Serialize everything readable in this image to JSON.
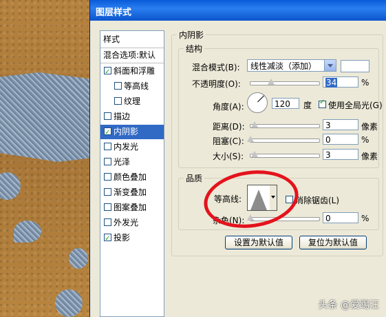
{
  "dialog": {
    "title": "图层样式"
  },
  "styles_panel": {
    "header": "样式",
    "blend_options": "混合选项:默认",
    "items": [
      {
        "label": "斜面和浮雕",
        "checked": true
      },
      {
        "label": "等高线",
        "checked": false
      },
      {
        "label": "纹理",
        "checked": false
      },
      {
        "label": "描边",
        "checked": false
      },
      {
        "label": "内阴影",
        "checked": true
      },
      {
        "label": "内发光",
        "checked": false
      },
      {
        "label": "光泽",
        "checked": false
      },
      {
        "label": "颜色叠加",
        "checked": false
      },
      {
        "label": "渐变叠加",
        "checked": false
      },
      {
        "label": "图案叠加",
        "checked": false
      },
      {
        "label": "外发光",
        "checked": false
      },
      {
        "label": "投影",
        "checked": true
      }
    ]
  },
  "inner_shadow": {
    "section": "内阴影",
    "structure": {
      "title": "结构",
      "blend_mode_label": "混合模式(B):",
      "blend_mode_value": "线性减淡（添加）",
      "opacity_label": "不透明度(O):",
      "opacity_value": "34",
      "percent": "%",
      "angle_label": "角度(A):",
      "angle_value": "120",
      "degree": "度",
      "global_light_label": "使用全局光(G)",
      "distance_label": "距离(D):",
      "distance_value": "3",
      "choke_label": "阻塞(C):",
      "choke_value": "0",
      "size_label": "大小(S):",
      "size_value": "3",
      "px": "像素"
    },
    "quality": {
      "title": "品质",
      "contour_label": "等高线:",
      "antialias_label": "消除锯齿(L)",
      "noise_label": "杂色(N):",
      "noise_value": "0"
    },
    "buttons": {
      "make_default": "设置为默认值",
      "reset_default": "复位为默认值"
    }
  },
  "watermark": "头条 @爱踢汪",
  "colors": {
    "accent": "#316ac5",
    "annotation": "#e4131c",
    "title_bar": "#0a5bd8"
  }
}
